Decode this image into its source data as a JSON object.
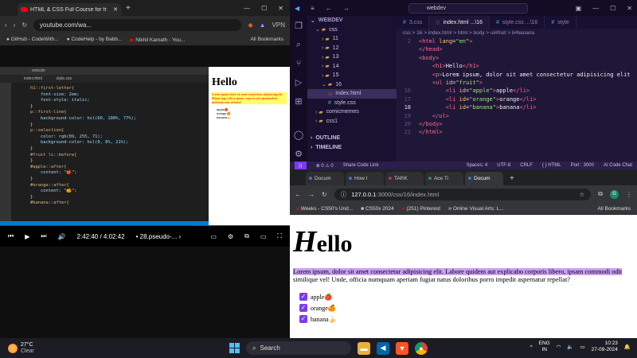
{
  "youtube": {
    "tab_title": "HTML & CSS Full Course for fr",
    "url": "youtube.com/wa...",
    "vpn": "VPN",
    "bookmarks": [
      "GitHub - CodeWith...",
      "CodeHelp - by Babb...",
      "Nikhil Kamath - You..."
    ],
    "all_bookmarks": "All Bookmarks",
    "time": "2:42:40 / 4:02:42",
    "chapter": "28.pseudo-...",
    "progress_fraction": 0.67,
    "mini_vscode_search": "website",
    "mini_tabs": [
      "index.html",
      "style.css"
    ],
    "mini_code": [
      "h1::first-letter{",
      "    font-size: 2em;",
      "    font-style: italic;",
      "}",
      "p::first-line{",
      "    background-color: hsl(60, 100%, 77%);",
      "}",
      "p::selection{",
      "    color: rgb(89, 255, 71);",
      "    background-color: hsl(0, 0%, 21%);",
      "}",
      "#fruit li::before{",
      "",
      "}",
      "#apple::after{",
      "    content: \"🍎\";",
      "}",
      "#orange::after{",
      "    content: \"🍊\";",
      "}",
      "#banana::after{"
    ],
    "mini_page": {
      "heading": "Hello",
      "para": "Lorem ipsum dolor sit amet consectetur adipisicing elit. Minus fuga officia ipsam corporis vel reprehenderit molestias rem veritatis!",
      "items": [
        "apple🍎",
        "orange🍊",
        "banana🍌"
      ]
    }
  },
  "vscode": {
    "search": "webdev",
    "explorer_title": "WEBDEV",
    "tree": [
      {
        "label": "css",
        "type": "folder-open"
      },
      {
        "label": "11",
        "type": "folder"
      },
      {
        "label": "12",
        "type": "folder"
      },
      {
        "label": "13",
        "type": "folder"
      },
      {
        "label": "14",
        "type": "folder"
      },
      {
        "label": "15",
        "type": "folder"
      },
      {
        "label": "16",
        "type": "folder-open"
      },
      {
        "label": "index.html",
        "type": "html",
        "selected": true
      },
      {
        "label": "style.css",
        "type": "css"
      },
      {
        "label": "comicmemes",
        "type": "folder"
      },
      {
        "label": "css1",
        "type": "folder"
      }
    ],
    "outline": "OUTLINE",
    "timeline": "TIMELINE",
    "tabs": [
      {
        "label": "3.css",
        "active": false
      },
      {
        "label": "index.html ...\\16",
        "active": true
      },
      {
        "label": "style.css ...\\16",
        "active": false
      },
      {
        "label": "style",
        "active": false
      }
    ],
    "breadcrumb": "css > 16 > index.html > html > body > ul#fruit > li#banana",
    "lines": [
      {
        "n": "2",
        "html": "<span class='tg'>&lt;html</span> <span class='at'>lang</span>=<span class='st'>\"en\"</span><span class='tg'>&gt;</span>"
      },
      {
        "n": "",
        "html": "<span class='tg'>&lt;/head&gt;</span>"
      },
      {
        "n": "",
        "html": "<span class='tg'>&lt;body&gt;</span>"
      },
      {
        "n": "",
        "html": ""
      },
      {
        "n": "",
        "html": "    <span class='tg'>&lt;h1&gt;</span><span class='tx'>Hello</span><span class='tg'>&lt;/h1&gt;</span>"
      },
      {
        "n": "",
        "html": ""
      },
      {
        "n": "",
        "html": "    <span class='tg'>&lt;p&gt;</span><span class='tx'>Lorem ipsum, dolor sit amet consectetur adipisicing elit</span>"
      },
      {
        "n": "",
        "html": ""
      },
      {
        "n": "",
        "html": "    <span class='tg'>&lt;ul</span> <span class='at'>id</span>=<span class='st'>\"fruit\"</span><span class='tg'>&gt;</span>"
      },
      {
        "n": "16",
        "html": "        <span class='tg'>&lt;li</span> <span class='at'>id</span>=<span class='st'>\"apple\"</span><span class='tg'>&gt;</span><span class='tx'>apple</span><span class='tg'>&lt;/li&gt;</span>"
      },
      {
        "n": "17",
        "html": "        <span class='tg'>&lt;li</span> <span class='at'>id</span>=<span class='st'>\"orange\"</span><span class='tg'>&gt;</span><span class='tx'>orange</span><span class='tg'>&lt;/li&gt;</span>"
      },
      {
        "n": "18",
        "html": "        <span class='tg'>&lt;li</span> <span class='at'>id</span>=<span class='st'>\"banana\"</span><span class='tg'>&gt;</span><span class='tx'>banana</span><span class='tg'>&lt;/li&gt;</span>",
        "current": true
      },
      {
        "n": "19",
        "html": "    <span class='tg'>&lt;/ul&gt;</span>"
      },
      {
        "n": "20",
        "html": "<span class='tg'>&lt;/body&gt;</span>"
      },
      {
        "n": "21",
        "html": "<span class='tg'>&lt;/html&gt;</span>"
      }
    ],
    "status": {
      "errors": "⊗ 0 ⚠ 0",
      "share": "Share Code Link",
      "spaces": "Spaces: 4",
      "encoding": "UTF-8",
      "eol": "CRLF",
      "lang": "{ } HTML",
      "port": "Port : 3000",
      "ai": "AI Code Chat"
    }
  },
  "chrome": {
    "tabs": [
      "Docum",
      "How I",
      "TARK",
      "Ace Ti",
      "Docum"
    ],
    "url_host": "127.0.0.1",
    "url_path": ":3000/css/16/index.html",
    "bookmarks": [
      "Weeks - CS50's Und...",
      "CS50x 2024",
      "(251) Pinterest",
      "Online Visual Arts: L...",
      "All Bookmarks"
    ],
    "page": {
      "h1_first": "H",
      "h1_rest": "ello",
      "para_line1": "Lorem ipsum, dolor sit amet consectetur adipisicing elit. Labore quidem aut explicabo corporis libero, ipsam commodi odit",
      "para_line2": "similique vel! Unde, officia numquam aperiam fugiat natus doloribus porro impedit aspernatur repellat?",
      "items": [
        "apple🍎",
        "orange🍊",
        "banana🍌"
      ]
    }
  },
  "taskbar": {
    "temp": "27°C",
    "weather": "Clear",
    "search": "Search",
    "lang": "ENG",
    "region": "IN",
    "time": "10:23",
    "date": "27-09-2024"
  }
}
